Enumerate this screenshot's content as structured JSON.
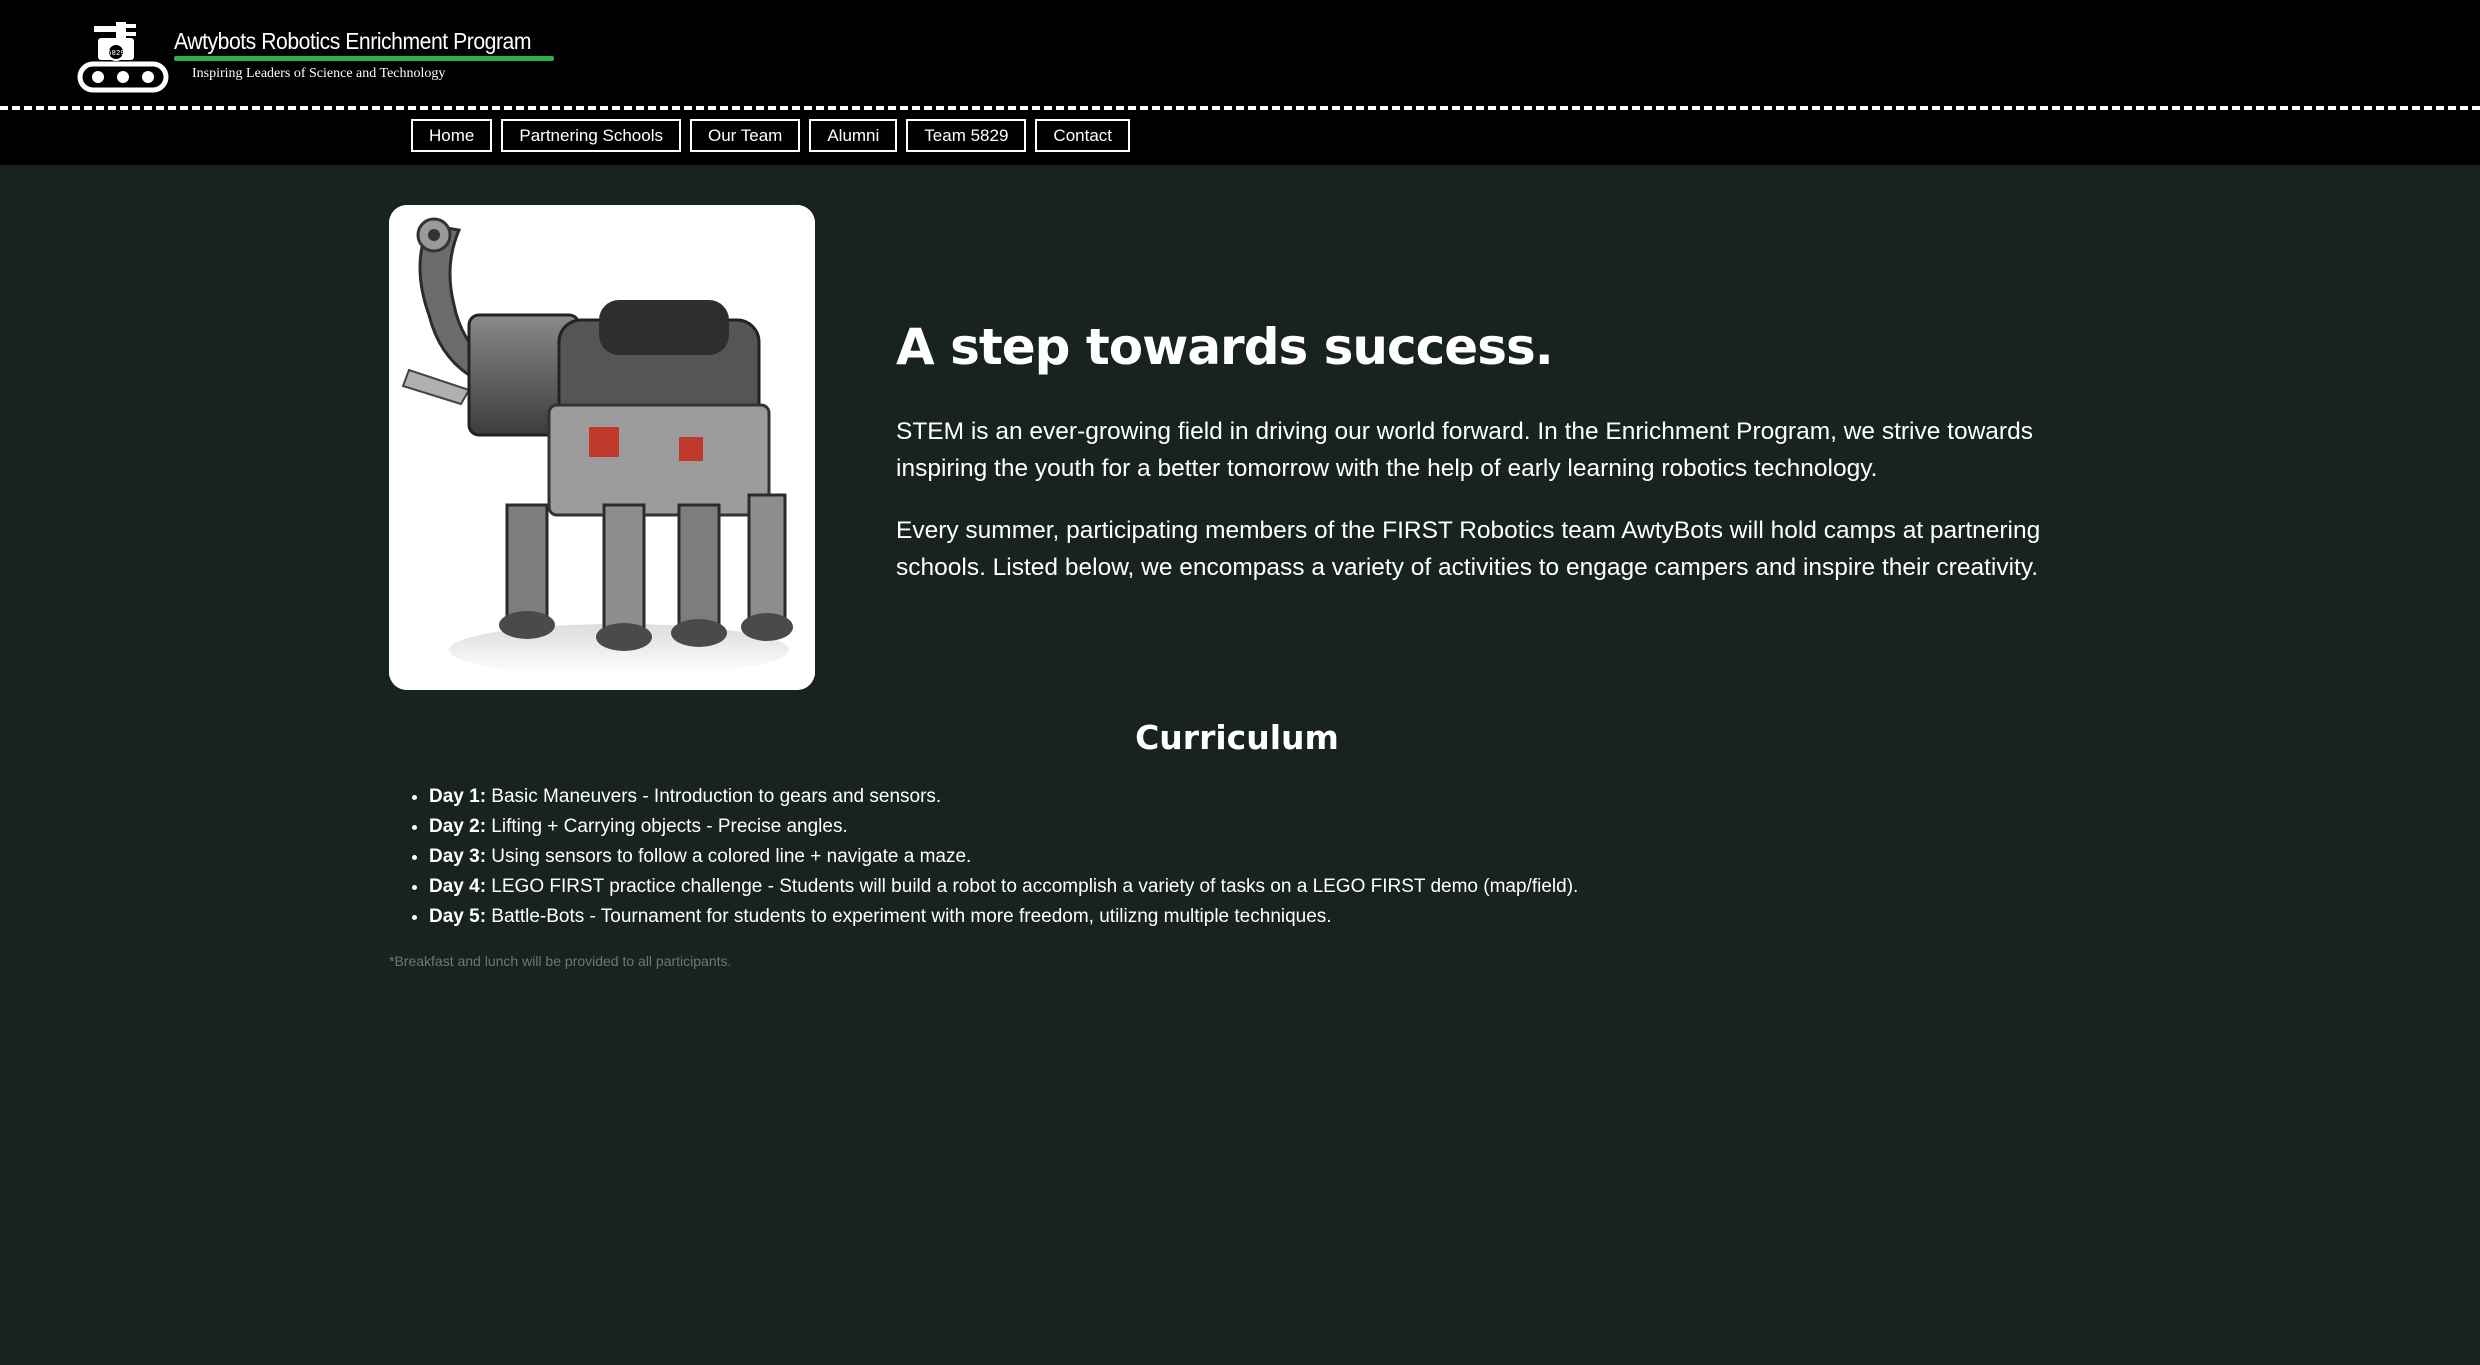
{
  "header": {
    "logo_title": "Awtybots Robotics Enrichment Program",
    "logo_tagline": "Inspiring Leaders of Science and Technology",
    "logo_badge": "5829"
  },
  "nav": {
    "items": [
      {
        "label": "Home"
      },
      {
        "label": "Partnering Schools"
      },
      {
        "label": "Our Team"
      },
      {
        "label": "Alumni"
      },
      {
        "label": "Team 5829"
      },
      {
        "label": "Contact"
      }
    ]
  },
  "hero": {
    "image_icon": "lego-robot-elephant-image",
    "title": "A step towards success.",
    "paragraph1": "STEM is an ever-growing field in driving our world forward. In the Enrichment Program, we strive towards inspiring the youth for a better tomorrow with the help of early learning robotics technology.",
    "paragraph2": "Every summer, participating members of the FIRST Robotics team AwtyBots will hold camps at partnering schools. Listed below, we encompass a variety of activities to engage campers and inspire their creativity."
  },
  "curriculum": {
    "title": "Curriculum",
    "items": [
      {
        "day": "Day 1:",
        "text": " Basic Maneuvers - Introduction to gears and sensors."
      },
      {
        "day": "Day 2:",
        "text": " Lifting + Carrying objects - Precise angles."
      },
      {
        "day": "Day 3:",
        "text": " Using sensors to follow a colored line + navigate a maze."
      },
      {
        "day": "Day 4:",
        "text": " LEGO FIRST practice challenge - Students will build a robot to accomplish a variety of tasks on a LEGO FIRST demo (map/field)."
      },
      {
        "day": "Day 5:",
        "text": " Battle-Bots - Tournament for students to experiment with more freedom, utilizng multiple techniques."
      }
    ],
    "footnote": "*Breakfast and lunch will be provided to all participants."
  },
  "colors": {
    "page_background": "#182220",
    "header_background": "#000000",
    "logo_accent": "#25b34a",
    "footnote_text": "#6f7774"
  }
}
